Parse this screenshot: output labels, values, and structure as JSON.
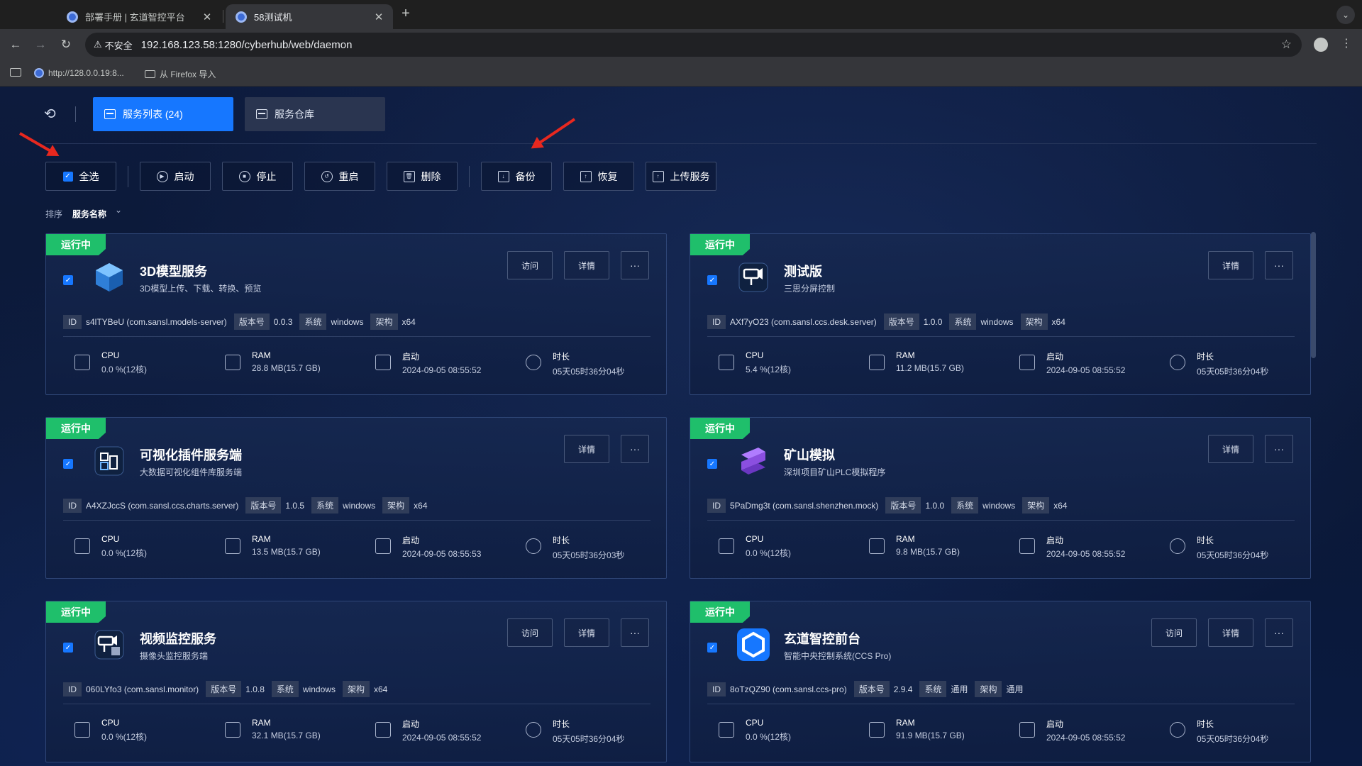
{
  "browser": {
    "tabs": [
      {
        "title": "部署手册 | 玄道智控平台",
        "active": false
      },
      {
        "title": "58测试机",
        "active": true
      }
    ],
    "insecure_label": "不安全",
    "url": "192.168.123.58:1280/cyberhub/web/daemon",
    "bookmarks": [
      "http://128.0.0.19:8...",
      "从 Firefox 导入"
    ]
  },
  "nav": {
    "service_list": "服务列表 (24)",
    "service_repo": "服务仓库"
  },
  "actions": {
    "select_all": "全选",
    "start": "启动",
    "stop": "停止",
    "restart": "重启",
    "delete": "删除",
    "backup": "备份",
    "restore": "恢复",
    "upload": "上传服务"
  },
  "sort": {
    "label": "排序",
    "value": "服务名称"
  },
  "labels": {
    "id": "ID",
    "version": "版本号",
    "os": "系统",
    "arch": "架构",
    "cpu": "CPU",
    "ram": "RAM",
    "start": "启动",
    "duration": "时长",
    "visit": "访问",
    "detail": "详情",
    "more": "···"
  },
  "services": [
    {
      "status": "运行中",
      "name": "3D模型服务",
      "desc": "3D模型上传、下载、转换、预览",
      "id": "s4lTYBeU (com.sansl.models-server)",
      "version": "0.0.3",
      "os": "windows",
      "arch": "x64",
      "cpu": "0.0 %(12核)",
      "ram": "28.8 MB(15.7 GB)",
      "start": "2024-09-05 08:55:52",
      "duration": "05天05时36分04秒",
      "has_visit": true,
      "logo": "cube",
      "logo_color": "#2f7fd8"
    },
    {
      "status": "运行中",
      "name": "测试版",
      "desc": "三思分屏控制",
      "id": "AXf7yO23 (com.sansl.ccs.desk.server)",
      "version": "1.0.0",
      "os": "windows",
      "arch": "x64",
      "cpu": "5.4 %(12核)",
      "ram": "11.2 MB(15.7 GB)",
      "start": "2024-09-05 08:55:52",
      "duration": "05天05时36分04秒",
      "has_visit": false,
      "logo": "monitor",
      "logo_color": "#ffffff"
    },
    {
      "status": "运行中",
      "name": "可视化插件服务端",
      "desc": "大数据可视化组件库服务端",
      "id": "A4XZJccS (com.sansl.ccs.charts.server)",
      "version": "1.0.5",
      "os": "windows",
      "arch": "x64",
      "cpu": "0.0 %(12核)",
      "ram": "13.5 MB(15.7 GB)",
      "start": "2024-09-05 08:55:53",
      "duration": "05天05时36分03秒",
      "has_visit": false,
      "logo": "blocks",
      "logo_color": "#ffffff"
    },
    {
      "status": "运行中",
      "name": "矿山模拟",
      "desc": "深圳项目矿山PLC模拟程序",
      "id": "5PaDmg3t (com.sansl.shenzhen.mock)",
      "version": "1.0.0",
      "os": "windows",
      "arch": "x64",
      "cpu": "0.0 %(12核)",
      "ram": "9.8 MB(15.7 GB)",
      "start": "2024-09-05 08:55:52",
      "duration": "05天05时36分04秒",
      "has_visit": false,
      "logo": "layers",
      "logo_color": "#8b4fe0"
    },
    {
      "status": "运行中",
      "name": "视频监控服务",
      "desc": "摄像头监控服务端",
      "id": "060LYfo3 (com.sansl.monitor)",
      "version": "1.0.8",
      "os": "windows",
      "arch": "x64",
      "cpu": "0.0 %(12核)",
      "ram": "32.1 MB(15.7 GB)",
      "start": "2024-09-05 08:55:52",
      "duration": "05天05时36分04秒",
      "has_visit": true,
      "logo": "camera",
      "logo_color": "#ffffff"
    },
    {
      "status": "运行中",
      "name": "玄道智控前台",
      "desc": "智能中央控制系统(CCS Pro)",
      "id": "8oTzQZ90 (com.sansl.ccs-pro)",
      "version": "2.9.4",
      "os": "通用",
      "arch": "通用",
      "cpu": "0.0 %(12核)",
      "ram": "91.9 MB(15.7 GB)",
      "start": "2024-09-05 08:55:52",
      "duration": "05天05时36分04秒",
      "has_visit": true,
      "logo": "hexagon",
      "logo_color": "#1677ff"
    }
  ]
}
